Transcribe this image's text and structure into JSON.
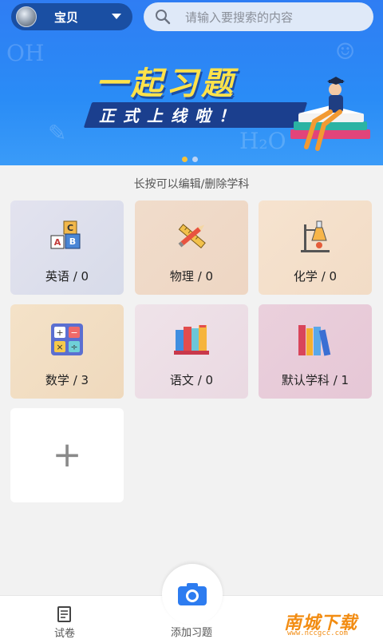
{
  "header": {
    "username": "宝贝",
    "search_placeholder": "请输入要搜索的内容"
  },
  "banner": {
    "headline": "一起习题",
    "subline": "正式上线啦！",
    "slide_count": 2,
    "active_slide": 1
  },
  "hint": "长按可以编辑/删除学科",
  "subjects": [
    {
      "label": "英语 / 0",
      "icon": "abc-blocks-icon"
    },
    {
      "label": "物理 / 0",
      "icon": "ruler-pencil-icon"
    },
    {
      "label": "化学 / 0",
      "icon": "flask-stand-icon"
    },
    {
      "label": "数学 / 3",
      "icon": "calculator-icon"
    },
    {
      "label": "语文 / 0",
      "icon": "books-icon"
    },
    {
      "label": "默认学科 / 1",
      "icon": "book-spines-icon"
    }
  ],
  "add_subject_icon": "plus-icon",
  "bottom_nav": {
    "paper_label": "试卷",
    "add_label": "添加习题"
  },
  "watermark": {
    "text": "南城下载",
    "url": "www.nccgcc.com"
  },
  "colors": {
    "banner_blue": "#2f7df3",
    "headline_yellow": "#ffe24a",
    "camera_blue": "#2d7cf0"
  }
}
